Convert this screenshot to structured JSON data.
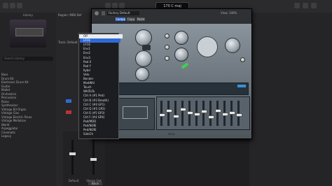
{
  "toolbar": {
    "lcd": "170",
    "lcd_text": "170  C maj"
  },
  "library": {
    "title": "Library",
    "search_placeholder": "Search Library",
    "items": [
      "Bass",
      "Drum Kit",
      "Electronic Drum Kit",
      "Guitar",
      "Mallet",
      "Orchestral",
      "Percussion",
      "Piano",
      "Synthesizer",
      "Vintage B3 Organ",
      "Vintage Clav",
      "Vintage Electric Piano",
      "Vintage Mellotron",
      "World",
      "Arpeggiator",
      "Cinematic",
      "Legacy"
    ]
  },
  "inspector": {
    "region_label": "Region: MIDI Def",
    "track_label": "Track: Default"
  },
  "plugin": {
    "preset": "Factory Default",
    "tabs": [
      "Compare",
      "Copy",
      "Paste"
    ],
    "view_label": "View: 100%",
    "name": "ES2"
  },
  "menu": {
    "items": [
      "Off",
      "LFO1",
      "LFO2",
      "Env1",
      "Env2",
      "Env3",
      "Pad X",
      "Pad Y",
      "Kybd",
      "Velo",
      "Bender",
      "ModWhl",
      "Touch",
      "WhlToTo",
      "Ctrl A (#1 Ped)",
      "Ctrl B (#2 Breath)",
      "Ctrl C (#4 GP1)",
      "Ctrl D (#5 GP2)",
      "Ctrl E (#5 GP3)",
      "Ctrl F (#4 GP4)",
      "Pad/MOD",
      "Pad/NOIE",
      "Ped/NOIE",
      "SideCh"
    ],
    "selected_index": 1,
    "first_highlight_index": 0
  },
  "mixer": {
    "labels": [
      "Default",
      "Stereo Out"
    ],
    "bounce": "Bnce"
  },
  "colors": {
    "accent": "#2f6ad6",
    "background": "#1b1b1d"
  }
}
